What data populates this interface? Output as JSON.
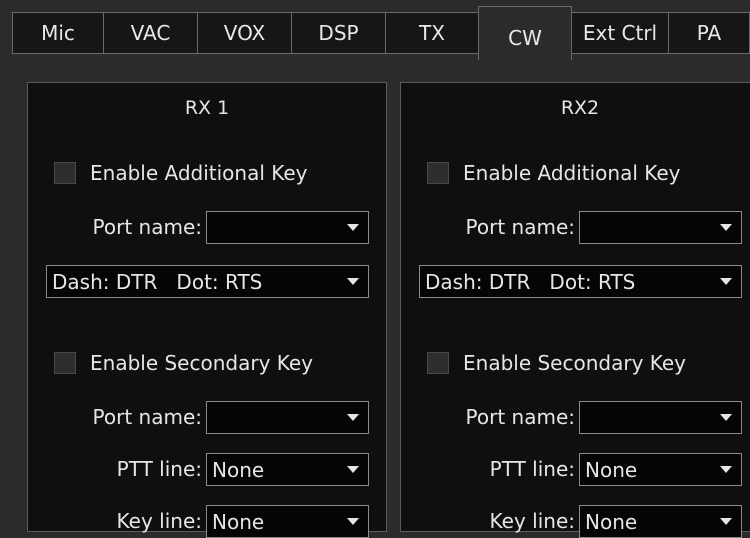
{
  "tabs": [
    "Mic",
    "VAC",
    "VOX",
    "DSP",
    "TX",
    "CW",
    "Ext Ctrl",
    "PA"
  ],
  "active_tab": "CW",
  "groups": [
    {
      "title": "RX 1",
      "enable_additional_key": "Enable Additional Key",
      "port_name_label": "Port name:",
      "port_name_value": "",
      "dash_dot_value": "Dash: DTR   Dot: RTS",
      "enable_secondary_key": "Enable Secondary Key",
      "port_name_label_2": "Port name:",
      "port_name_value_2": "",
      "ptt_line_label": "PTT line:",
      "ptt_line_value": "None",
      "key_line_label": "Key line:",
      "key_line_value": "None"
    },
    {
      "title": "RX2",
      "enable_additional_key": "Enable Additional Key",
      "port_name_label": "Port name:",
      "port_name_value": "",
      "dash_dot_value": "Dash: DTR   Dot: RTS",
      "enable_secondary_key": "Enable Secondary Key",
      "port_name_label_2": "Port name:",
      "port_name_value_2": "",
      "ptt_line_label": "PTT line:",
      "ptt_line_value": "None",
      "key_line_label": "Key line:",
      "key_line_value": "None"
    }
  ]
}
